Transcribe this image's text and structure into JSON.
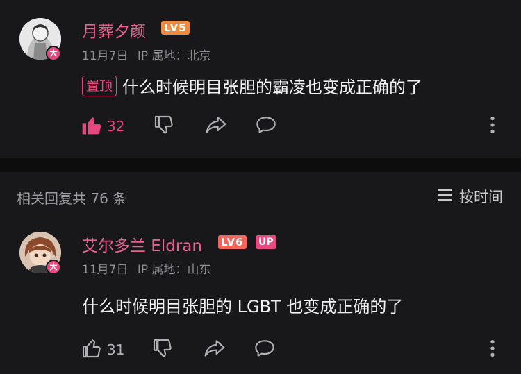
{
  "comments": [
    {
      "username": "月葬夕颜",
      "level": "LV5",
      "avatar_badge": "大",
      "date": "11月7日",
      "ip_location": "IP 属地：北京",
      "pinned_label": "置顶",
      "text": "什么时候明目张胆的霸凌也变成正确的了",
      "likes": "32",
      "liked": true
    },
    {
      "username": "艾尔多兰 Eldran",
      "level": "LV6",
      "up_badge": "UP",
      "avatar_badge": "大",
      "date": "11月7日",
      "ip_location": "IP 属地：山东",
      "text": "什么时候明目张胆的 LGBT 也变成正确的了",
      "likes": "31",
      "liked": false
    }
  ],
  "replies": {
    "title": "相关回复共 76 条",
    "sort_label": "按时间"
  },
  "colors": {
    "background": "#18181a",
    "accent_pink": "#e7497f",
    "username_pink": "#ec5f8c",
    "lv5": "#f08a3c",
    "lv6": "#f4665b"
  },
  "icons": [
    "thumbs-up-icon",
    "thumbs-down-icon",
    "share-icon",
    "comment-icon",
    "more-icon",
    "sort-icon"
  ]
}
